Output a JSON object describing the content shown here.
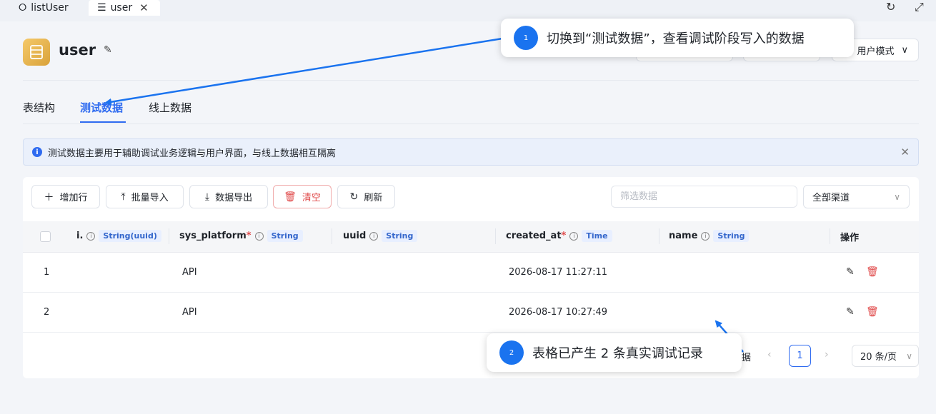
{
  "window_tabs": [
    {
      "label": "listUser",
      "icon": "sitemap-icon"
    },
    {
      "label": "user",
      "icon": "table-icon"
    }
  ],
  "header": {
    "title": "user",
    "mode_label": "用户模式"
  },
  "page_tabs": [
    "表结构",
    "测试数据",
    "线上数据"
  ],
  "active_tab": "测试数据",
  "notice": "测试数据主要用于辅助调试业务逻辑与用户界面，与线上数据相互隔离",
  "toolbar": {
    "add_row": "增加行",
    "import": "批量导入",
    "export": "数据导出",
    "clear": "清空",
    "refresh": "刷新",
    "filter_placeholder": "筛选数据",
    "channel": "全部渠道"
  },
  "columns": [
    {
      "name": "i.",
      "required": false,
      "type": "String(uuid)"
    },
    {
      "name": "sys_platform",
      "required": true,
      "type": "String"
    },
    {
      "name": "uuid",
      "required": false,
      "type": "String"
    },
    {
      "name": "created_at",
      "required": true,
      "type": "Time"
    },
    {
      "name": "name",
      "required": false,
      "type": "String"
    }
  ],
  "actions_header": "操作",
  "rows": [
    {
      "index": "1",
      "sys_platform": "API",
      "created_at": "2026-08-17 11:27:11"
    },
    {
      "index": "2",
      "sys_platform": "API",
      "created_at": "2026-08-17 10:27:49"
    }
  ],
  "pagination": {
    "total_suffix": "据",
    "current_page": "1",
    "page_size": "20 条/页"
  },
  "callouts": [
    {
      "number": "1",
      "text": "切换到“测试数据”，查看调试阶段写入的数据"
    },
    {
      "number": "2",
      "text": "表格已产生 2 条真实调试记录"
    }
  ],
  "colors": {
    "accent": "#2f6bf0",
    "danger": "#e04a4a",
    "callout_badge": "#1a73ef"
  }
}
